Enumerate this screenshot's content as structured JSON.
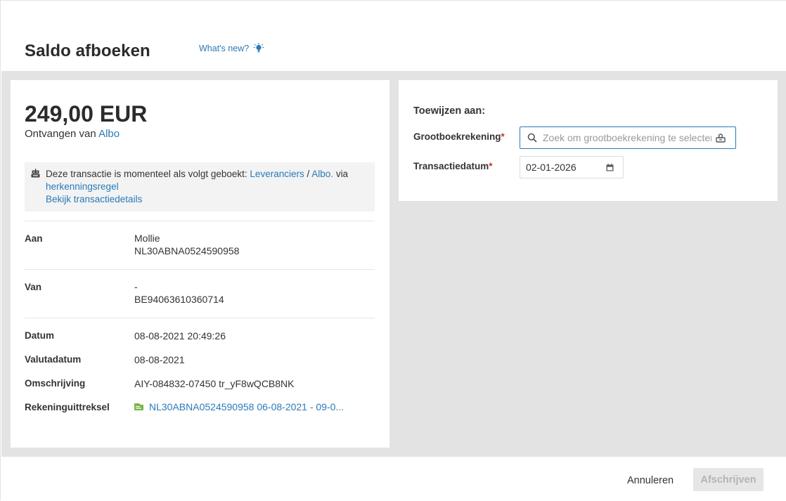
{
  "header": {
    "title": "Saldo afboeken",
    "whats_new": "What's new?"
  },
  "transaction": {
    "amount": "249,00 EUR",
    "received_prefix": "Ontvangen van",
    "received_from": "Albo",
    "notice": {
      "text_prefix": "Deze transactie is momenteel als volgt geboekt:",
      "category": "Leveranciers",
      "separator": "/",
      "contact": "Albo.",
      "via": "via",
      "rule_link": "herkenningsregel",
      "details_link": "Bekijk transactiedetails"
    },
    "to": {
      "label": "Aan",
      "name": "Mollie",
      "iban": "NL30ABNA0524590958"
    },
    "from": {
      "label": "Van",
      "name": "-",
      "iban": "BE94063610360714"
    },
    "date": {
      "label": "Datum",
      "value": "08-08-2021 20:49:26"
    },
    "value_date": {
      "label": "Valutadatum",
      "value": "08-08-2021"
    },
    "description": {
      "label": "Omschrijving",
      "value": "AIY-084832-07450 tr_yF8wQCB8NK"
    },
    "statement": {
      "label": "Rekeninguittreksel",
      "value": "NL30ABNA0524590958 06-08-2021 - 09-0..."
    }
  },
  "assign": {
    "title": "Toewijzen aan:",
    "ledger_label": "Grootboekrekening",
    "ledger_placeholder": "Zoek om grootboekrekening te selecteren",
    "date_label": "Transactiedatum",
    "date_value": "02-01-2026",
    "required_mark": "*"
  },
  "footer": {
    "cancel": "Annuleren",
    "submit": "Afschrijven"
  },
  "colors": {
    "accent": "#2a7ab8",
    "required": "#c0392b",
    "statement_icon": "#7ab648"
  }
}
